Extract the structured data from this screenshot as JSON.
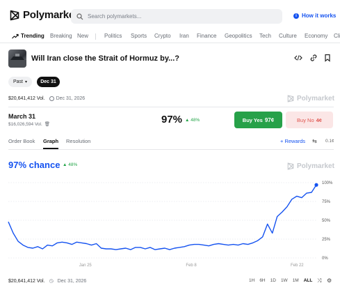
{
  "header": {
    "brand": "Polymarket",
    "search_placeholder": "Search polymarkets...",
    "how_it_works": "How it works"
  },
  "nav": {
    "items": [
      "Trending",
      "Breaking",
      "New",
      "Politics",
      "Sports",
      "Crypto",
      "Iran",
      "Finance",
      "Geopolitics",
      "Tech",
      "Culture",
      "Economy",
      "Cli"
    ]
  },
  "market": {
    "title": "Will Iran close the Strait of Hormuz by...?",
    "past_label": "Past",
    "date_pill": "Dec 31",
    "volume": "$20,641,412 Vol.",
    "end_date": "Dec 31, 2026",
    "watermark": "Polymarket"
  },
  "outcome": {
    "name": "March 31",
    "volume": "$16,026,594 Vol.",
    "percent": "97%",
    "delta": "48%",
    "buy_yes_label": "Buy Yes",
    "buy_yes_price": "97¢",
    "buy_no_label": "Buy No",
    "buy_no_price": "4¢"
  },
  "tabs": {
    "order_book": "Order Book",
    "graph": "Graph",
    "resolution": "Resolution",
    "rewards": "Rewards",
    "small_value": "0.1¢"
  },
  "chart_header": {
    "chance": "97% chance",
    "delta": "48%"
  },
  "chart_data": {
    "type": "line",
    "ylim": [
      0,
      100
    ],
    "y_ticks": [
      "100%",
      "75%",
      "50%",
      "25%",
      "0%"
    ],
    "x_ticks": [
      "Jan 25",
      "Feb 8",
      "Feb 22"
    ],
    "series": [
      {
        "color": "#1452f0",
        "points": [
          [
            0,
            48
          ],
          [
            1,
            33
          ],
          [
            2,
            22
          ],
          [
            3,
            17
          ],
          [
            4,
            14
          ],
          [
            5,
            13
          ],
          [
            6,
            15
          ],
          [
            7,
            12
          ],
          [
            8,
            17
          ],
          [
            9,
            16
          ],
          [
            10,
            20
          ],
          [
            11,
            21
          ],
          [
            12,
            20
          ],
          [
            13,
            18
          ],
          [
            14,
            21
          ],
          [
            15,
            20
          ],
          [
            16,
            19
          ],
          [
            17,
            17
          ],
          [
            18,
            19
          ],
          [
            19,
            13
          ],
          [
            20,
            12
          ],
          [
            21,
            12
          ],
          [
            22,
            11
          ],
          [
            23,
            12
          ],
          [
            24,
            13
          ],
          [
            25,
            11
          ],
          [
            26,
            14
          ],
          [
            27,
            14
          ],
          [
            28,
            12
          ],
          [
            29,
            14
          ],
          [
            30,
            11
          ],
          [
            31,
            12
          ],
          [
            32,
            13
          ],
          [
            33,
            11
          ],
          [
            34,
            13
          ],
          [
            35,
            14
          ],
          [
            36,
            15
          ],
          [
            37,
            17
          ],
          [
            38,
            18
          ],
          [
            39,
            18
          ],
          [
            40,
            17
          ],
          [
            41,
            16
          ],
          [
            42,
            18
          ],
          [
            43,
            19
          ],
          [
            44,
            18
          ],
          [
            45,
            17
          ],
          [
            46,
            18
          ],
          [
            47,
            17
          ],
          [
            48,
            19
          ],
          [
            49,
            18
          ],
          [
            50,
            20
          ],
          [
            51,
            23
          ],
          [
            52,
            28
          ],
          [
            53,
            45
          ],
          [
            54,
            33
          ],
          [
            55,
            55
          ],
          [
            56,
            61
          ],
          [
            57,
            68
          ],
          [
            58,
            78
          ],
          [
            59,
            82
          ],
          [
            60,
            80
          ],
          [
            61,
            86
          ],
          [
            62,
            87
          ],
          [
            63,
            97
          ]
        ]
      }
    ]
  },
  "footer": {
    "volume": "$20,641,412 Vol.",
    "end_date": "Dec 31, 2026",
    "ranges": [
      "1H",
      "6H",
      "1D",
      "1W",
      "1M",
      "ALL"
    ],
    "active_range": "ALL"
  },
  "colors": {
    "accent": "#1452f0",
    "yes": "#27a149",
    "no_bg": "#fbe6e6",
    "no_text": "#e0554f",
    "up": "#22a447"
  }
}
